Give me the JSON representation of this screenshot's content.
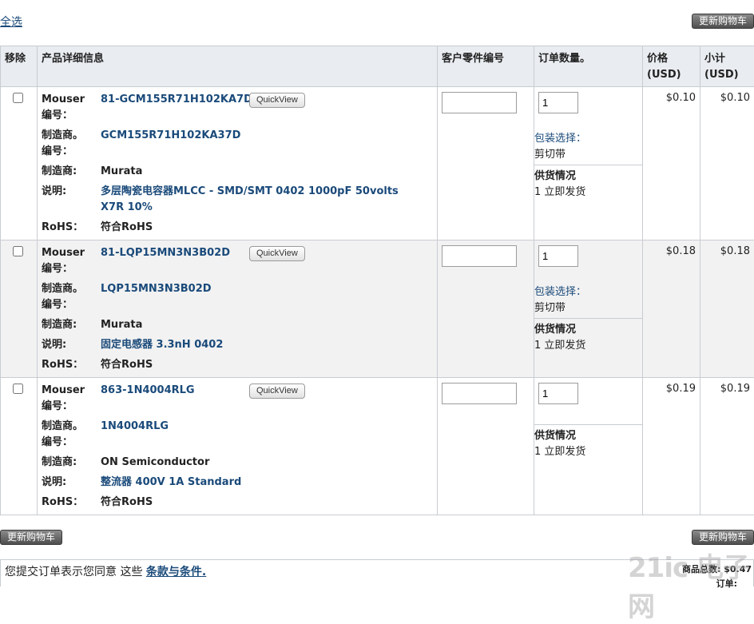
{
  "header": {
    "select_all": "全选",
    "update_cart": "更新购物车"
  },
  "columns": {
    "remove": "移除",
    "details": "产品详细信息",
    "customer_part": "客户零件编号",
    "order_qty": "订单数量。",
    "price": "价格\n(USD)",
    "subtotal": "小计\n(USD)"
  },
  "labels": {
    "mouser_no": "Mouser\n编号：",
    "mfr_no": "制造商。\n编号：",
    "mfr": "制造商:",
    "desc": "说明:",
    "rohs": "RoHS：",
    "quickview": "QuickView",
    "packaging": "包装选择：",
    "availability": "供货情况"
  },
  "items": [
    {
      "mouser_no": "81-GCM155R71H102KA7D",
      "mfr_no": "GCM155R71H102KA37D",
      "mfr": "Murata",
      "desc": "多层陶瓷电容器MLCC - SMD/SMT 0402 1000pF 50volts X7R 10%",
      "rohs": "符合RoHS",
      "qty": "1",
      "packaging": "剪切带",
      "availability": "1 立即发货",
      "price": "$0.10",
      "subtotal": "$0.10"
    },
    {
      "mouser_no": "81-LQP15MN3N3B02D",
      "mfr_no": "LQP15MN3N3B02D",
      "mfr": "Murata",
      "desc": "固定电感器 3.3nH 0402",
      "rohs": "符合RoHS",
      "qty": "1",
      "packaging": "剪切带",
      "availability": "1 立即发货",
      "price": "$0.18",
      "subtotal": "$0.18"
    },
    {
      "mouser_no": "863-1N4004RLG",
      "mfr_no": "1N4004RLG",
      "mfr": "ON Semiconductor",
      "desc": "整流器 400V 1A Standard",
      "rohs": "符合RoHS",
      "qty": "1",
      "availability": "1 立即发货",
      "price": "$0.19",
      "subtotal": "$0.19"
    }
  ],
  "footer": {
    "update_cart_left": "更新购物车",
    "update_cart_right": "更新购物车",
    "terms_text": "您提交订单表示您同意 这些 ",
    "terms_link": "条款与条件.",
    "total_label": "商品总数:",
    "total_value": "$0.47",
    "partial_label": "订单:",
    "watermark": "21ic 电子网"
  }
}
